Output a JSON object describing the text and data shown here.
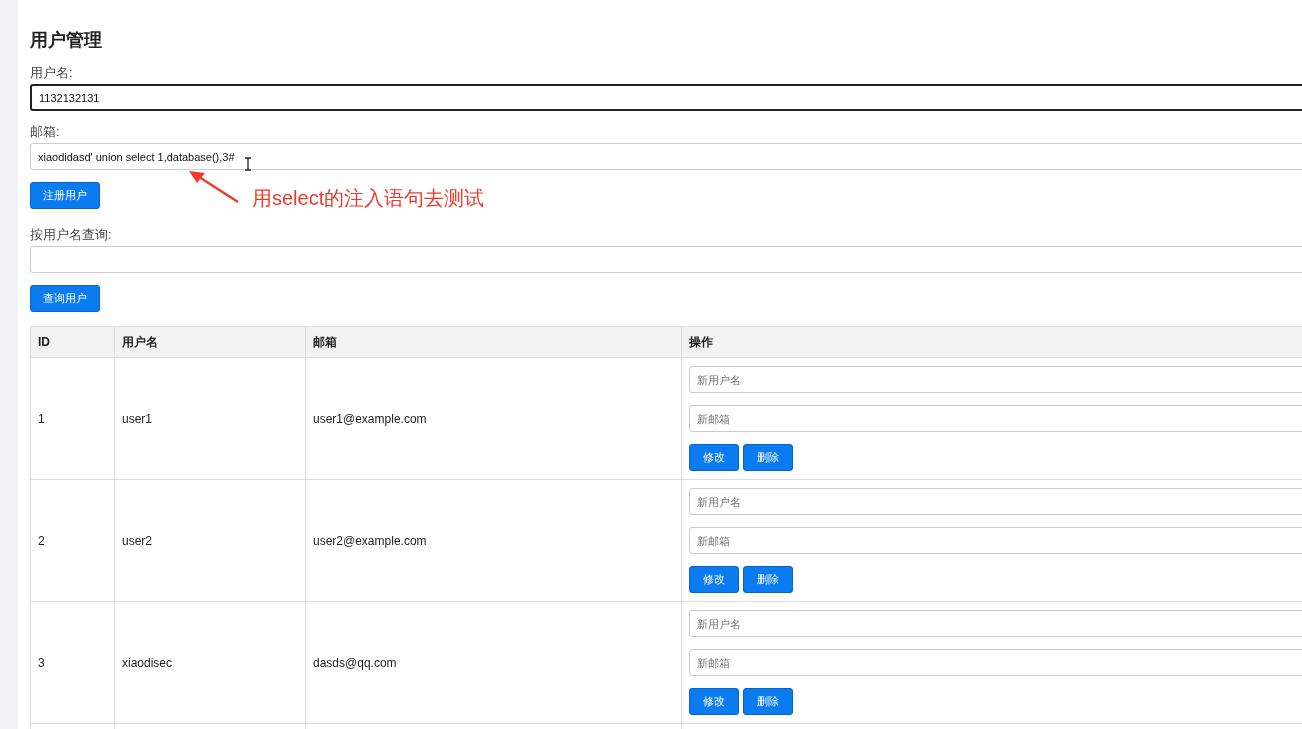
{
  "page": {
    "title": "用户管理"
  },
  "register_form": {
    "fields": [
      {
        "label": "用户名:",
        "value": "1132132131",
        "focused": true
      },
      {
        "label": "邮箱:",
        "value": "xiaodidasd' union select 1,database(),3#",
        "focused": false
      }
    ],
    "button": "注册用户"
  },
  "annotation": {
    "text": "用select的注入语句去测试"
  },
  "search": {
    "label": "按用户名查询:",
    "button": "查询用户"
  },
  "table": {
    "columns": [
      "ID",
      "用户名",
      "邮箱",
      "操作"
    ],
    "rows": [
      {
        "cells": [
          "1",
          "user1",
          "user1@example.com"
        ],
        "username_placeholder": "新用户名",
        "email_placeholder": "新邮箱",
        "edit_button": "修改",
        "delete_button": "删除"
      },
      {
        "cells": [
          "2",
          "user2",
          "user2@example.com"
        ],
        "username_placeholder": "新用户名",
        "email_placeholder": "新邮箱",
        "edit_button": "修改",
        "delete_button": "删除"
      },
      {
        "cells": [
          "3",
          "xiaodisec",
          "dasds@qq.com"
        ],
        "username_placeholder": "新用户名",
        "email_placeholder": "新邮箱",
        "edit_button": "修改",
        "delete_button": "删除"
      }
    ]
  }
}
